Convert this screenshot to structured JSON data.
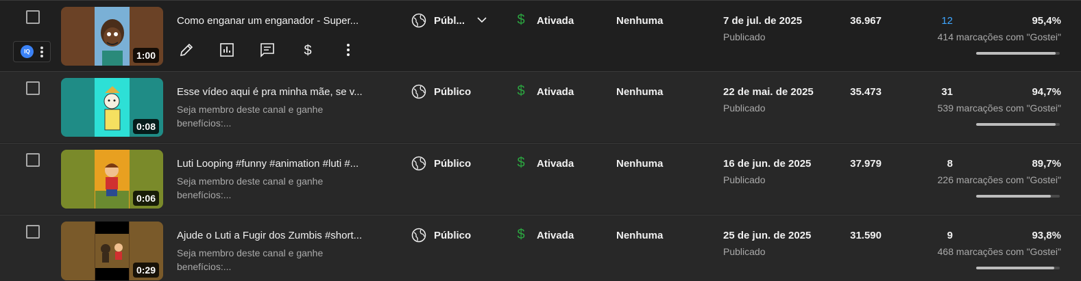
{
  "rows": [
    {
      "title": "Como enganar um enganador - Super...",
      "description": "",
      "duration": "1:00",
      "visibility": "Públ...",
      "monetization": "Ativada",
      "restrictions": "Nenhuma",
      "date": "7 de jul. de 2025",
      "date_status": "Publicado",
      "views": "36.967",
      "comments": "12",
      "likes_pct": "95,4%",
      "likes_count": "414 marcações com \"Gostei\"",
      "likes_ratio": 0.954,
      "thumb_colors": [
        "#6b4226",
        "#7ab0d6",
        "#6b4226"
      ],
      "ext_badge": "IQ"
    },
    {
      "title": "Esse vídeo aqui é pra minha mãe, se v...",
      "description": "Seja membro deste canal e ganhe benefícios:...",
      "duration": "0:08",
      "visibility": "Público",
      "monetization": "Ativada",
      "restrictions": "Nenhuma",
      "date": "22 de mai. de 2025",
      "date_status": "Publicado",
      "views": "35.473",
      "comments": "31",
      "likes_pct": "94,7%",
      "likes_count": "539 marcações com \"Gostei\"",
      "likes_ratio": 0.947,
      "thumb_colors": [
        "#1f8c86",
        "#2de0d6",
        "#1f8c86"
      ]
    },
    {
      "title": "Luti Looping #funny #animation #luti #...",
      "description": "Seja membro deste canal e ganhe benefícios:...",
      "duration": "0:06",
      "visibility": "Público",
      "monetization": "Ativada",
      "restrictions": "Nenhuma",
      "date": "16 de jun. de 2025",
      "date_status": "Publicado",
      "views": "37.979",
      "comments": "8",
      "likes_pct": "89,7%",
      "likes_count": "226 marcações com \"Gostei\"",
      "likes_ratio": 0.897,
      "thumb_colors": [
        "#7a8a2a",
        "#e8a020",
        "#7a8a2a"
      ]
    },
    {
      "title": "Ajude o Luti a Fugir dos Zumbis #short...",
      "description": "Seja membro deste canal e ganhe benefícios:...",
      "duration": "0:29",
      "visibility": "Público",
      "monetization": "Ativada",
      "restrictions": "Nenhuma",
      "date": "25 de jun. de 2025",
      "date_status": "Publicado",
      "views": "31.590",
      "comments": "9",
      "likes_pct": "93,8%",
      "likes_count": "468 marcações com \"Gostei\"",
      "likes_ratio": 0.938,
      "thumb_colors": [
        "#7a5a2a",
        "#5a4020",
        "#7a5a2a"
      ]
    }
  ],
  "row_actions": [
    "edit-icon",
    "analytics-icon",
    "comments-icon",
    "monetization-icon",
    "more-options-icon"
  ],
  "colors": {
    "accent_link": "#3ea6ff",
    "monetization_green": "#2ba640",
    "background": "#1f1f1f",
    "row_background": "#282828"
  }
}
